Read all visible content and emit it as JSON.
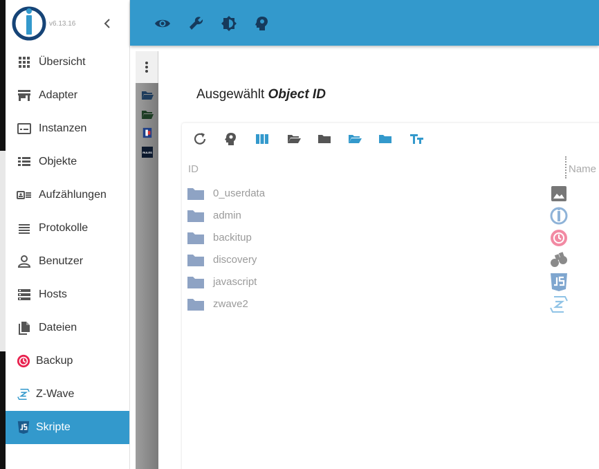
{
  "app": {
    "version": "v6.13.16"
  },
  "sidebar": {
    "items": [
      {
        "label": "Übersicht",
        "icon": "grid-icon"
      },
      {
        "label": "Adapter",
        "icon": "store-icon"
      },
      {
        "label": "Instanzen",
        "icon": "instances-icon"
      },
      {
        "label": "Objekte",
        "icon": "list-icon"
      },
      {
        "label": "Aufzählungen",
        "icon": "enum-icon"
      },
      {
        "label": "Protokolle",
        "icon": "log-icon"
      },
      {
        "label": "Benutzer",
        "icon": "user-icon"
      },
      {
        "label": "Hosts",
        "icon": "server-icon"
      },
      {
        "label": "Dateien",
        "icon": "files-icon"
      },
      {
        "label": "Backup",
        "icon": "backup-icon"
      },
      {
        "label": "Z-Wave",
        "icon": "zwave-icon"
      },
      {
        "label": "Skripte",
        "icon": "javascript-icon",
        "active": true
      }
    ]
  },
  "topbar": {
    "icons": [
      "eye-icon",
      "wrench-icon",
      "brightness-icon",
      "expert-head-icon"
    ]
  },
  "dialog": {
    "title_prefix": "Ausgewählt",
    "title_emphasis": "Object ID",
    "columns": {
      "id": "ID",
      "name": "Name"
    },
    "rows": [
      {
        "id": "0_userdata",
        "icon": "image-icon"
      },
      {
        "id": "admin",
        "icon": "iobroker-icon"
      },
      {
        "id": "backitup",
        "icon": "backup-icon"
      },
      {
        "id": "discovery",
        "icon": "binoculars-icon"
      },
      {
        "id": "javascript",
        "icon": "javascript-icon"
      },
      {
        "id": "zwave2",
        "icon": "zwave-icon"
      }
    ]
  },
  "colors": {
    "accent": "#3399cc",
    "folder": "#8ea3c4",
    "logo": "#164477"
  }
}
